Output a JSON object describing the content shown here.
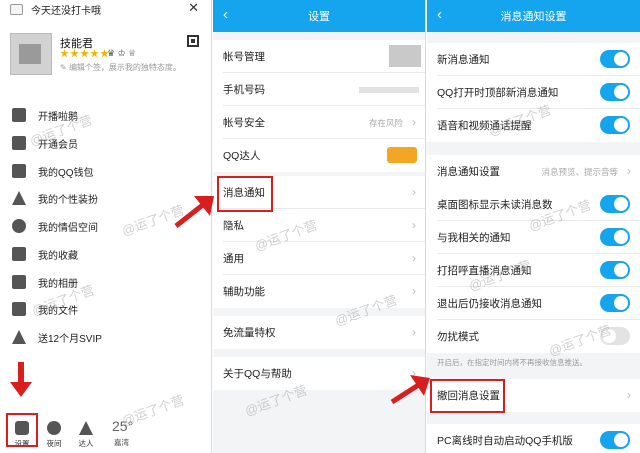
{
  "panel1": {
    "top_text": "今天还没打卡哦",
    "username": "技能君",
    "signature": "编辑个签，展示我的独特态度。",
    "menu": [
      {
        "label": "开播啦鹅",
        "icon": "broadcast-icon"
      },
      {
        "label": "开通会员",
        "icon": "member-icon"
      },
      {
        "label": "我的QQ钱包",
        "icon": "wallet-icon"
      },
      {
        "label": "我的个性装扮",
        "icon": "shirt-icon"
      },
      {
        "label": "我的情侣空间",
        "icon": "heart-icon"
      },
      {
        "label": "我的收藏",
        "icon": "bookmark-icon"
      },
      {
        "label": "我的相册",
        "icon": "album-icon"
      },
      {
        "label": "我的文件",
        "icon": "folder-icon"
      },
      {
        "label": "送12个月SVIP",
        "icon": "gift-icon"
      }
    ],
    "bottom": {
      "settings": "设置",
      "night": "夜间",
      "expert": "达人",
      "temperature": "25°",
      "location": "嘉湾"
    }
  },
  "panel2": {
    "title": "设置",
    "rows": [
      {
        "label": "帐号管理",
        "hint": ""
      },
      {
        "label": "手机号码",
        "hint": ""
      },
      {
        "label": "帐号安全",
        "hint": "存在风险"
      },
      {
        "label": "QQ达人",
        "hint": ""
      },
      {
        "label": "消息通知",
        "hint": ""
      },
      {
        "label": "隐私",
        "hint": ""
      },
      {
        "label": "通用",
        "hint": ""
      },
      {
        "label": "辅助功能",
        "hint": ""
      },
      {
        "label": "免流量特权",
        "hint": ""
      },
      {
        "label": "关于QQ与帮助",
        "hint": ""
      }
    ]
  },
  "panel3": {
    "title": "消息通知设置",
    "rows": [
      {
        "label": "新消息通知",
        "on": true
      },
      {
        "label": "QQ打开时顶部新消息通知",
        "on": true
      },
      {
        "label": "语音和视频通话提醒",
        "on": true
      },
      {
        "label": "消息通知设置",
        "hint": "消息预览、提示音等"
      },
      {
        "label": "桌面图标显示未读消息数",
        "on": true
      },
      {
        "label": "与我相关的通知",
        "on": true
      },
      {
        "label": "打招呼直播消息通知",
        "on": true
      },
      {
        "label": "退出后仍接收消息通知",
        "on": true
      },
      {
        "label": "勿扰模式",
        "on": false
      },
      {
        "label": "撤回消息设置",
        "hint": ""
      },
      {
        "label": "PC离线时自动启动QQ手机版",
        "on": true
      }
    ],
    "note": "开启后，在指定时间内将不再接收信息推送。"
  },
  "watermark": "@运了个营",
  "colors": {
    "accent": "#15a5ee",
    "highlight": "#d81e1e"
  }
}
